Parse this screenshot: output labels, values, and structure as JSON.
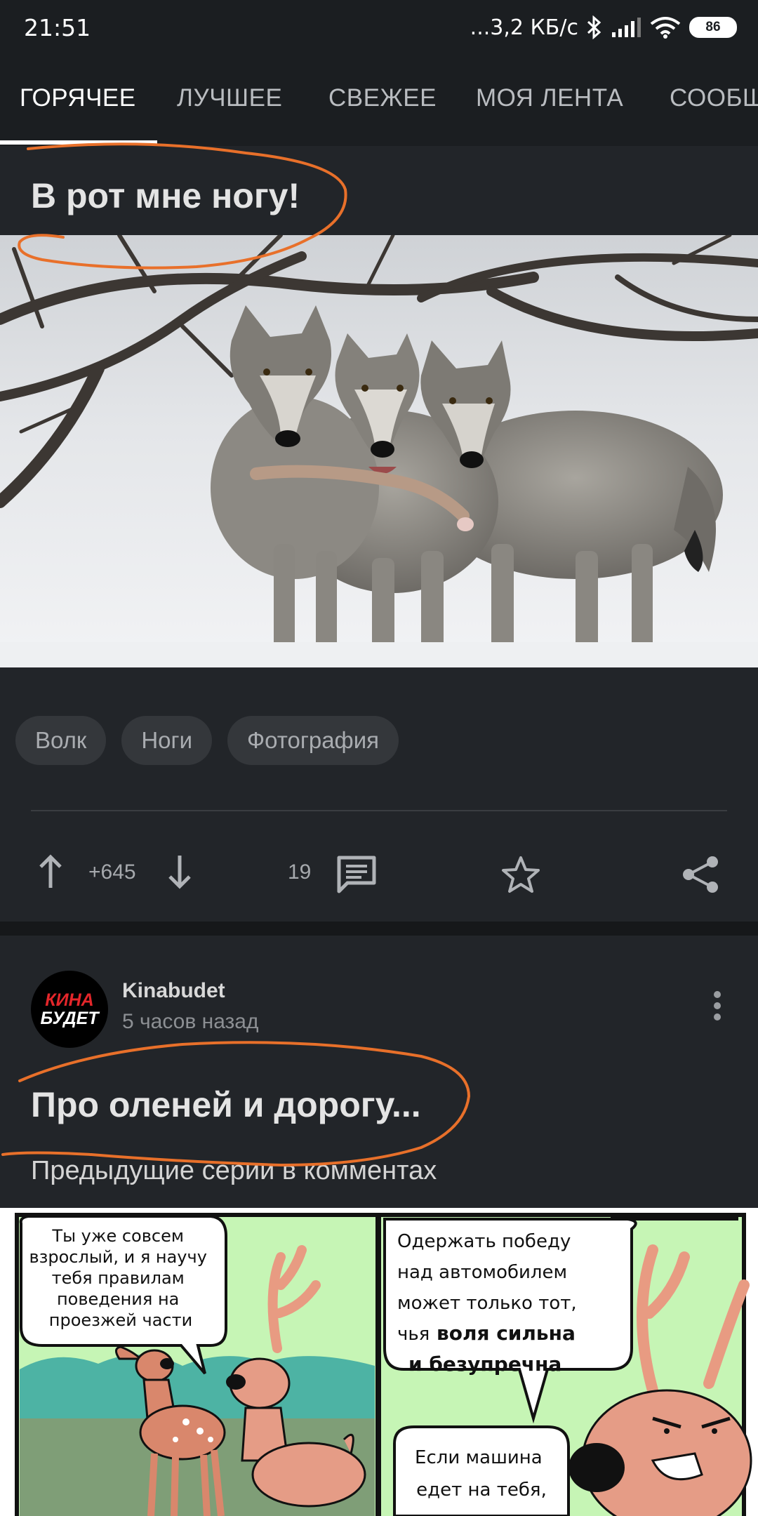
{
  "status_bar": {
    "time": "21:51",
    "network_speed": "...3,2 КБ/с",
    "battery": "86",
    "icons": [
      "bluetooth-icon",
      "signal-icon",
      "wifi-icon",
      "battery-icon"
    ]
  },
  "tabs": [
    {
      "label": "ГОРЯЧЕЕ",
      "active": true
    },
    {
      "label": "ЛУЧШЕЕ",
      "active": false
    },
    {
      "label": "СВЕЖЕЕ",
      "active": false
    },
    {
      "label": "МОЯ ЛЕНТА",
      "active": false
    },
    {
      "label": "СООБЩ",
      "active": false
    }
  ],
  "post1": {
    "title": "В рот мне ногу!",
    "tags": [
      "Волк",
      "Ноги",
      "Фотография"
    ],
    "rating": "+645",
    "comments": "19",
    "icons": [
      "upvote-icon",
      "downvote-icon",
      "comment-icon",
      "star-icon",
      "share-icon"
    ]
  },
  "post2": {
    "avatar_text": [
      "КИНА",
      "БУДЕТ"
    ],
    "author": "Kinabudet",
    "time": "5 часов назад",
    "title": "Про оленей и дорогу...",
    "subtitle": "Предыдущие серии в комментах",
    "comic": {
      "left_bubble": [
        "Ты уже совсем",
        "взрослый, и я научу",
        "тебя правилам",
        "поведения на",
        "проезжей части"
      ],
      "right_bubble_plain": [
        "Одержать победу",
        "над автомобилем",
        "может только тот,",
        "чья"
      ],
      "right_bubble_bold": [
        "воля сильна",
        "и безупречна"
      ],
      "bottom_bubble": [
        "Если машина",
        "едет на тебя,"
      ]
    }
  },
  "colors": {
    "background": "#1b1e21",
    "card": "#222529",
    "annotation_scribble": "#e8702a"
  }
}
